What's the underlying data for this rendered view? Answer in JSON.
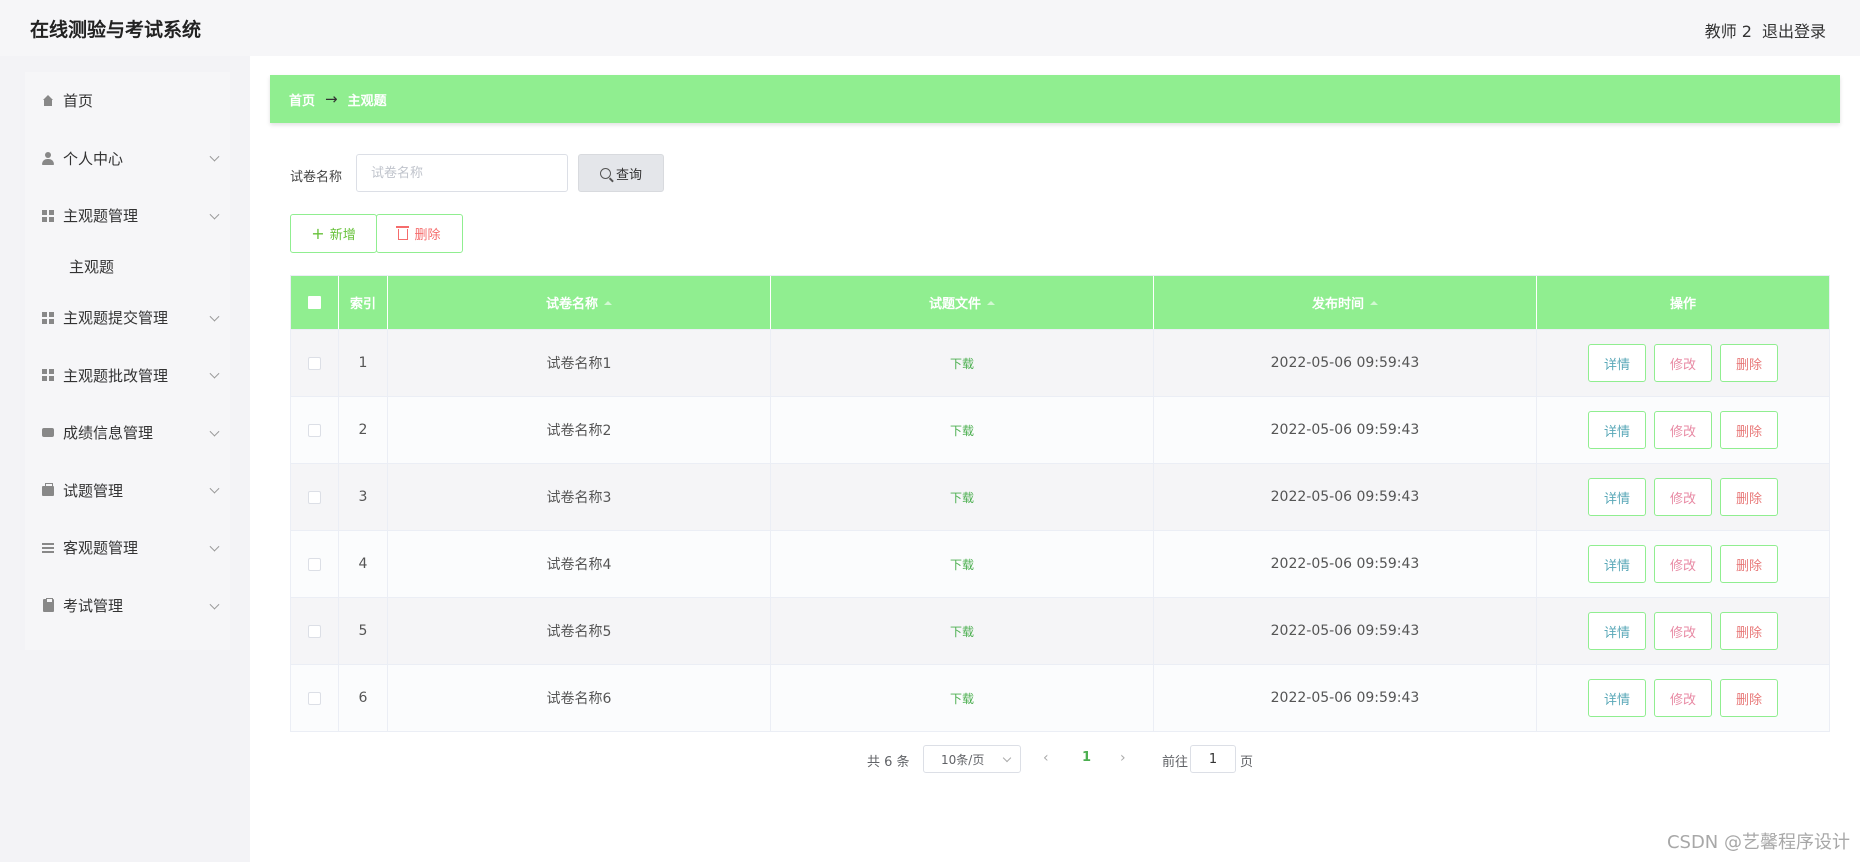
{
  "header": {
    "app_title": "在线测验与考试系统",
    "user_name": "教师 2",
    "logout_label": "退出登录"
  },
  "sidebar": {
    "items": [
      {
        "label": "首页",
        "icon": "home-icon"
      },
      {
        "label": "个人中心",
        "icon": "user-icon"
      },
      {
        "label": "主观题管理",
        "icon": "grid-icon",
        "expanded": true,
        "children": [
          {
            "label": "主观题"
          }
        ]
      },
      {
        "label": "主观题提交管理",
        "icon": "grid-icon"
      },
      {
        "label": "主观题批改管理",
        "icon": "grid-icon"
      },
      {
        "label": "成绩信息管理",
        "icon": "chat-icon"
      },
      {
        "label": "试题管理",
        "icon": "briefcase-icon"
      },
      {
        "label": "客观题管理",
        "icon": "list-icon"
      },
      {
        "label": "考试管理",
        "icon": "clipboard-icon"
      }
    ]
  },
  "breadcrumb": {
    "home": "首页",
    "arrow": "→",
    "current": "主观题"
  },
  "search": {
    "label": "试卷名称",
    "placeholder": "试卷名称",
    "button_label": "查询"
  },
  "toolbar": {
    "add_label": "新增",
    "delete_label": "删除"
  },
  "table": {
    "columns": [
      "索引",
      "试卷名称",
      "试题文件",
      "发布时间",
      "操作"
    ],
    "rows": [
      {
        "index": "1",
        "name": "试卷名称1",
        "file": "下载",
        "time": "2022-05-06 09:59:43"
      },
      {
        "index": "2",
        "name": "试卷名称2",
        "file": "下载",
        "time": "2022-05-06 09:59:43"
      },
      {
        "index": "3",
        "name": "试卷名称3",
        "file": "下载",
        "time": "2022-05-06 09:59:43"
      },
      {
        "index": "4",
        "name": "试卷名称4",
        "file": "下载",
        "time": "2022-05-06 09:59:43"
      },
      {
        "index": "5",
        "name": "试卷名称5",
        "file": "下载",
        "time": "2022-05-06 09:59:43"
      },
      {
        "index": "6",
        "name": "试卷名称6",
        "file": "下载",
        "time": "2022-05-06 09:59:43"
      }
    ],
    "actions": {
      "detail": "详情",
      "edit": "修改",
      "delete": "删除"
    }
  },
  "pagination": {
    "total": "共 6 条",
    "page_size": "10条/页",
    "current_page": "1",
    "goto_label": "前往",
    "goto_value": "1",
    "page_suffix": "页"
  },
  "watermark": "CSDN @艺馨程序设计",
  "colors": {
    "accent": "#90ee90",
    "link": "#4caf50",
    "danger": "#f56c6c"
  }
}
